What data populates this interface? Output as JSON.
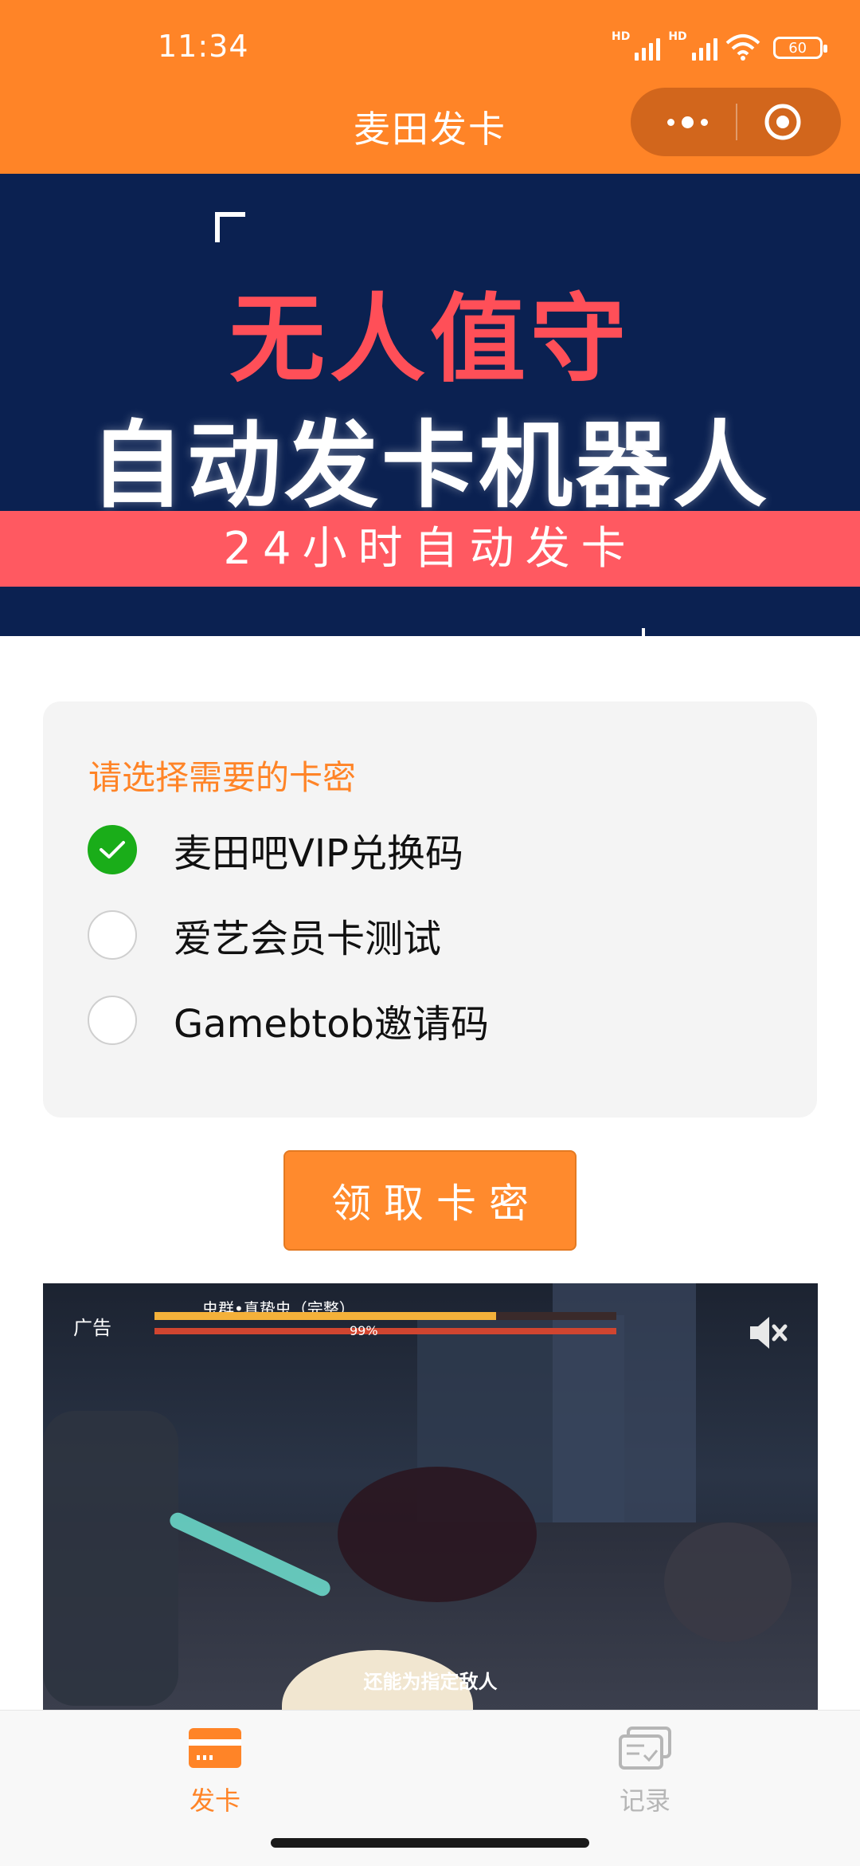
{
  "status_bar": {
    "time": "11:34",
    "network1": "HD",
    "network2": "HD",
    "battery": "60"
  },
  "nav": {
    "title": "麦田发卡",
    "more_icon": "more-dots-icon",
    "close_icon": "target-icon"
  },
  "banner": {
    "line1": "无人值守",
    "line2": "自动发卡机器人",
    "strip": "24小时自动发卡"
  },
  "selection": {
    "title": "请选择需要的卡密",
    "options": [
      {
        "label": "麦田吧VIP兑换码",
        "checked": true
      },
      {
        "label": "爱艺会员卡测试",
        "checked": false
      },
      {
        "label": "Gamebtob邀请码",
        "checked": false
      }
    ]
  },
  "action": {
    "claim_label": "领取卡密"
  },
  "ad": {
    "label": "广告",
    "boss_title": "虫群•真蛰虫（完整）",
    "hp_percent": "99%",
    "hp_fraction": 0.74,
    "subtitle": "还能为指定敌人",
    "mute_icon": "speaker-muted-icon"
  },
  "tabbar": {
    "tabs": [
      {
        "label": "发卡",
        "icon": "card-icon",
        "active": true
      },
      {
        "label": "记录",
        "icon": "records-icon",
        "active": false
      }
    ]
  },
  "colors": {
    "brand": "#FF8427",
    "check": "#1AAD19",
    "banner_bg": "#0B2151",
    "banner_red": "#FF5961"
  }
}
